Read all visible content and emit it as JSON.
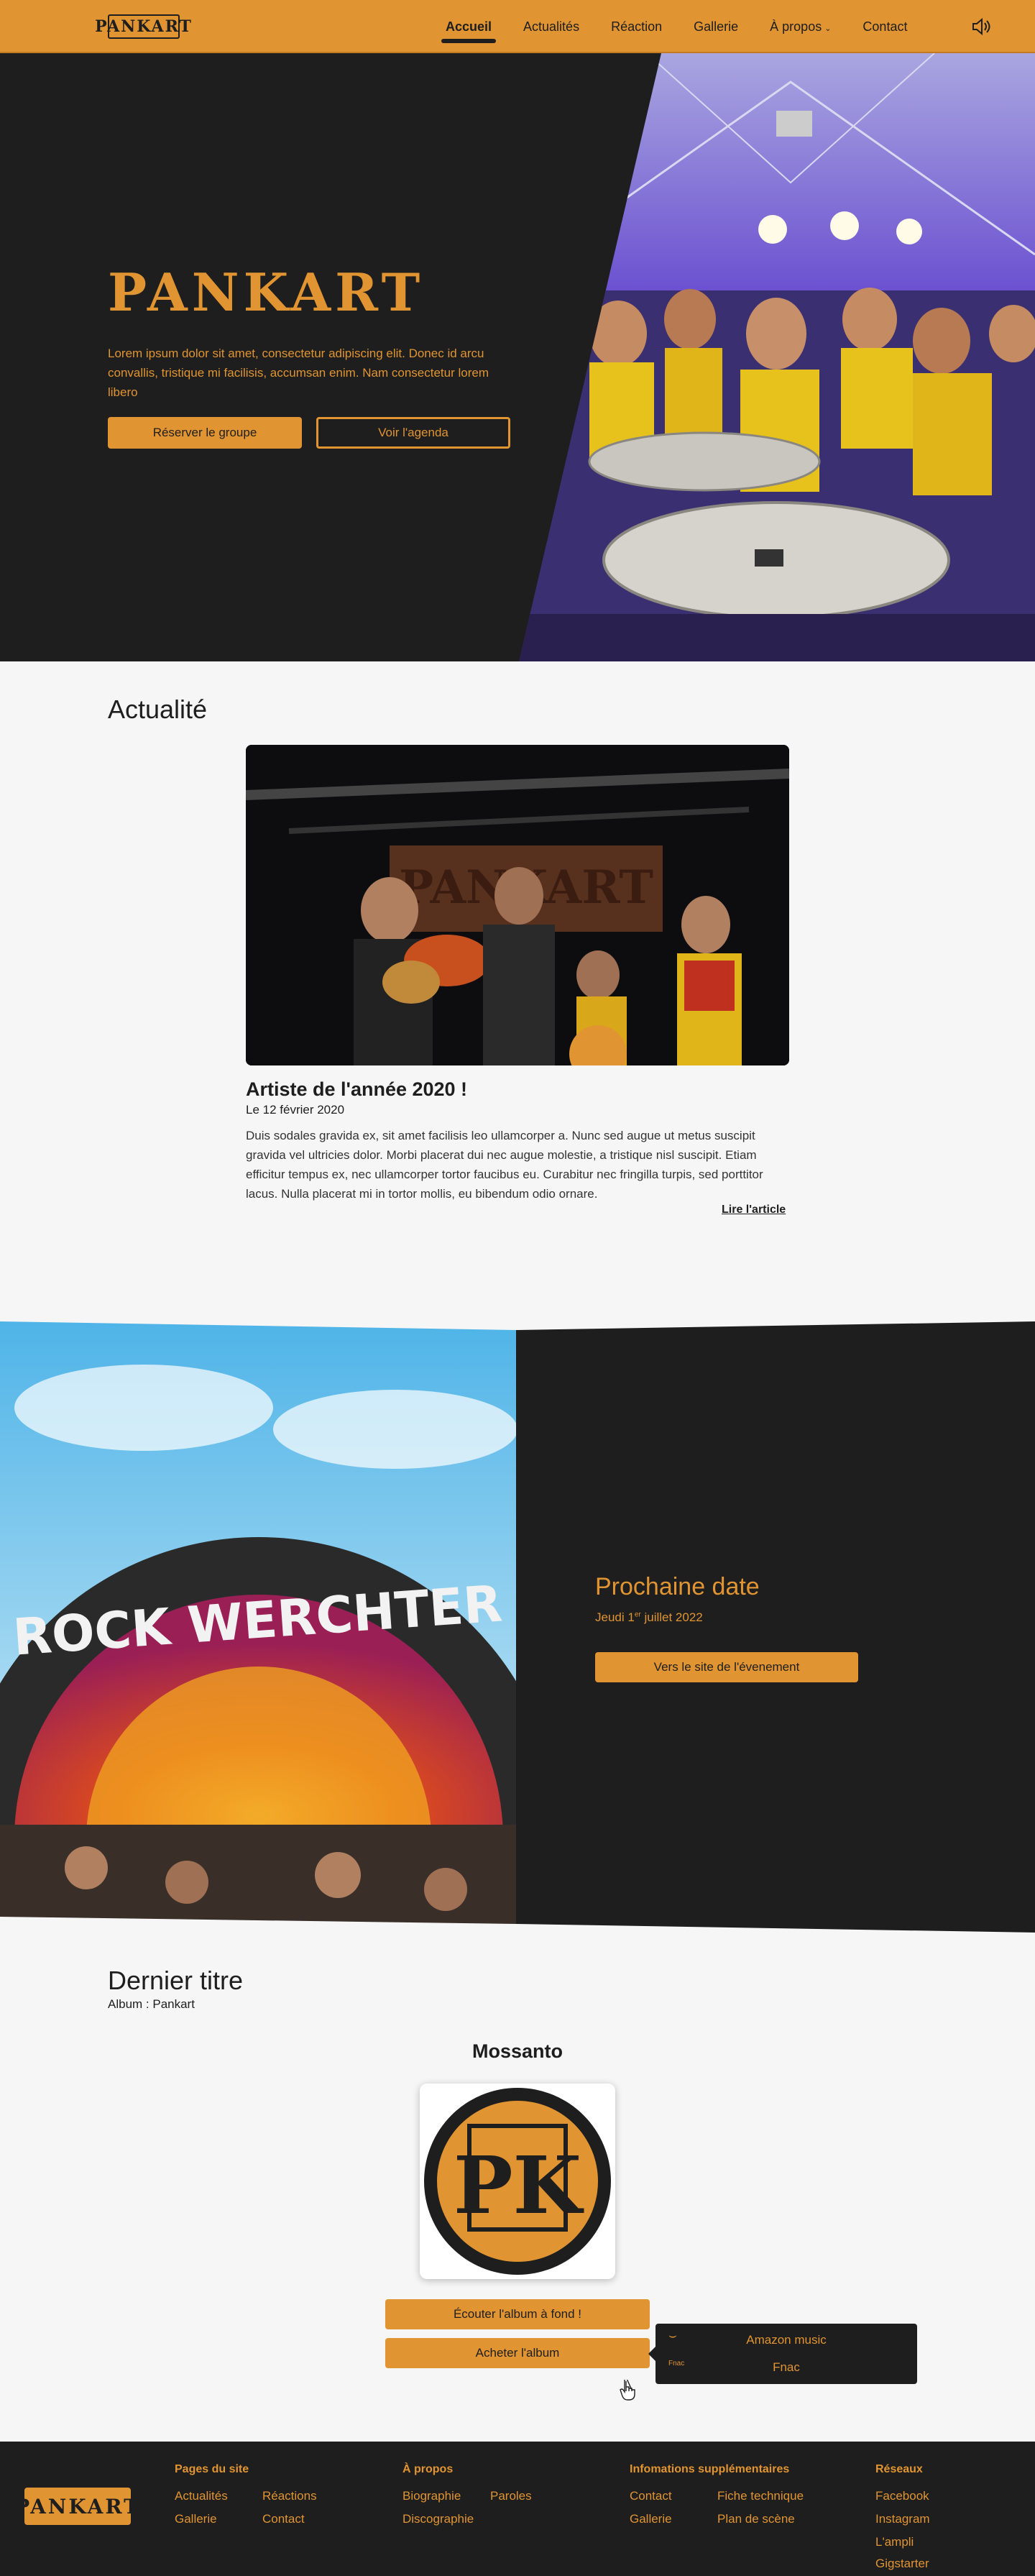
{
  "nav": {
    "logo": "PANKART",
    "items": [
      {
        "label": "Accueil"
      },
      {
        "label": "Actualités"
      },
      {
        "label": "Réaction"
      },
      {
        "label": "Gallerie"
      },
      {
        "label": "À propos"
      },
      {
        "label": "Contact"
      }
    ],
    "dropdown_icon": "chevron-down-icon",
    "sound_icon": "speaker-icon"
  },
  "hero": {
    "brand": "PANKART",
    "lead": "Lorem ipsum dolor sit amet, consectetur adipiscing elit. Donec id arcu convallis, tristique mi facilisis, accumsan enim. Nam consectetur lorem libero",
    "book_button": "Réserver le groupe",
    "agenda_button": "Voir l'agenda"
  },
  "news": {
    "heading": "Actualité",
    "banner_text": "PANKART",
    "title": "Artiste de l'année 2020 !",
    "date": "Le 12 février 2020",
    "body": "Duis sodales gravida ex, sit amet facilisis leo ullamcorper a. Nunc sed augue ut metus suscipit gravida vel ultricies dolor. Morbi placerat dui nec augue molestie, a tristique nisl suscipit. Etiam efficitur tempus ex, nec ullamcorper tortor faucibus eu. Curabitur nec fringilla turpis, sed porttitor lacus. Nulla placerat mi in tortor mollis, eu bibendum odio ornare.",
    "read_more": "Lire l'article"
  },
  "next_date": {
    "stage_text": "ROCK WERCHTER",
    "title": "Prochaine date",
    "date_prefix": "Jeudi 1",
    "date_sup": "er",
    "date_suffix": " juillet 2022",
    "button": "Vers le site de l'évenement"
  },
  "last_track": {
    "heading": "Dernier titre",
    "album": "Album : Pankart",
    "track": "Mossanto",
    "cover_letters": "PK",
    "listen_button": "Écouter l'album à fond !",
    "buy_button": "Acheter l'album",
    "shops": [
      {
        "label": "Amazon music",
        "icon": "amazon-icon",
        "mark": "⌣"
      },
      {
        "label": "Fnac",
        "icon": "fnac-icon",
        "mark": "Fnac"
      }
    ]
  },
  "footer": {
    "logo": "PANKART",
    "columns": [
      {
        "title": "Pages du site",
        "links": [
          "Actualités",
          "Réactions",
          "Gallerie",
          "Contact"
        ]
      },
      {
        "title": "À propos",
        "links": [
          "Biographie",
          "Paroles",
          "Discographie"
        ]
      },
      {
        "title": "Infomations supplémentaires",
        "links": [
          "Contact",
          "Fiche technique",
          "Gallerie",
          "Plan de scène"
        ]
      },
      {
        "title": "Réseaux",
        "links": [
          "Facebook",
          "Instagram",
          "L'ampli",
          "Gigstarter"
        ]
      }
    ]
  },
  "colors": {
    "accent": "#e09432",
    "dark": "#1e1e1e",
    "light": "#f6f6f6"
  }
}
